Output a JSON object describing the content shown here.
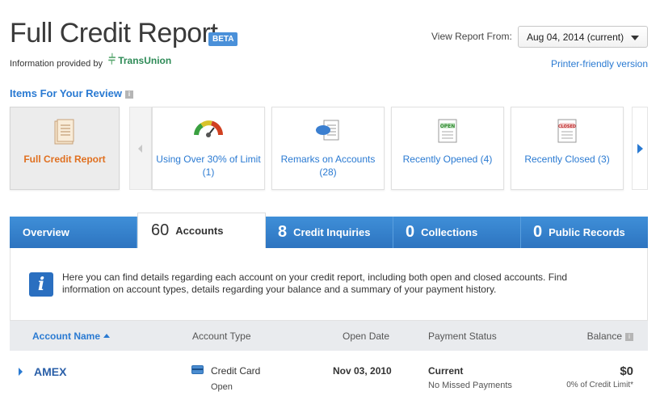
{
  "header": {
    "title": "Full Credit Report",
    "beta_badge": "BETA",
    "provided_by": "Information provided by",
    "provider_name": "TransUnion",
    "view_label": "View Report From:",
    "view_value": "Aug 04, 2014 (current)",
    "printer_link": "Printer-friendly version"
  },
  "review": {
    "title": "Items For Your Review",
    "info_icon": "i",
    "cards": [
      {
        "label": "Full Credit Report",
        "icon": "document-icon",
        "active": true
      },
      {
        "label": "Using Over 30% of Limit (1)",
        "icon": "gauge-icon"
      },
      {
        "label": "Remarks on Accounts (28)",
        "icon": "comment-document-icon"
      },
      {
        "label": "Recently Opened (4)",
        "icon": "open-document-icon",
        "badge": "OPEN"
      },
      {
        "label": "Recently Closed (3)",
        "icon": "closed-document-icon",
        "badge": "CLOSED"
      }
    ]
  },
  "tabs": [
    {
      "num": "",
      "label": "Overview"
    },
    {
      "num": "60",
      "label": "Accounts",
      "active": true
    },
    {
      "num": "8",
      "label": "Credit Inquiries"
    },
    {
      "num": "0",
      "label": "Collections"
    },
    {
      "num": "0",
      "label": "Public Records"
    }
  ],
  "info_panel": {
    "icon": "i",
    "text": "Here you can find details regarding each account on your credit report, including both open and closed accounts. Find information on account types, details regarding your balance and a summary of your payment history."
  },
  "table": {
    "columns": {
      "name": "Account Name",
      "type": "Account Type",
      "open_date": "Open Date",
      "payment_status": "Payment Status",
      "balance": "Balance"
    },
    "balance_info_icon": "i",
    "rows": [
      {
        "name": "AMEX",
        "type": "Credit Card",
        "status": "Open",
        "open_date": "Nov 03, 2010",
        "payment_status": "Current",
        "payment_sub": "No Missed Payments",
        "balance": "$0",
        "balance_sub": "0% of Credit Limit*"
      }
    ]
  },
  "colors": {
    "accent_blue": "#2a7ad2",
    "tab_blue": "#3584cc",
    "active_orange": "#e07020"
  }
}
